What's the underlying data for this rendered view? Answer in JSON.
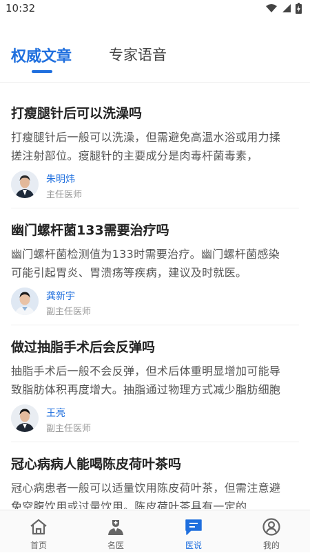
{
  "status_bar": {
    "time": "10:32"
  },
  "tabs": [
    {
      "label": "权威文章",
      "active": true
    },
    {
      "label": "专家语音",
      "active": false
    }
  ],
  "articles": [
    {
      "title": "打瘦腿针后可以洗澡吗",
      "summary": "打瘦腿针后一般可以洗澡，但需避免高温水浴或用力揉搓注射部位。瘦腿针的主要成分是肉毒杆菌毒素，",
      "doctor_name": "朱明炜",
      "doctor_title": "主任医师"
    },
    {
      "title": "幽门螺杆菌133需要治疗吗",
      "summary": "幽门螺杆菌检测值为133时需要治疗。幽门螺杆菌感染可能引起胃炎、胃溃疡等疾病，建议及时就医。",
      "doctor_name": "龚新宇",
      "doctor_title": "副主任医师"
    },
    {
      "title": "做过抽脂手术后会反弹吗",
      "summary": "抽脂手术后一般不会反弹，但术后体重明显增加可能导致脂肪体积再度增大。抽脂通过物理方式减少脂肪细胞",
      "doctor_name": "王亮",
      "doctor_title": "副主任医师"
    },
    {
      "title": "冠心病病人能喝陈皮荷叶茶吗",
      "summary": "冠心病患者一般可以适量饮用陈皮荷叶茶，但需注意避免空腹饮用或过量饮用。陈皮荷叶茶具有一定的",
      "doctor_name": "",
      "doctor_title": ""
    }
  ],
  "bottom_nav": [
    {
      "label": "首页",
      "icon": "home-icon",
      "active": false
    },
    {
      "label": "名医",
      "icon": "doctor-icon",
      "active": false
    },
    {
      "label": "医说",
      "icon": "message-icon",
      "active": true
    },
    {
      "label": "我的",
      "icon": "profile-icon",
      "active": false
    }
  ],
  "colors": {
    "accent": "#1f6fde",
    "text": "#222222",
    "muted": "#555555"
  }
}
